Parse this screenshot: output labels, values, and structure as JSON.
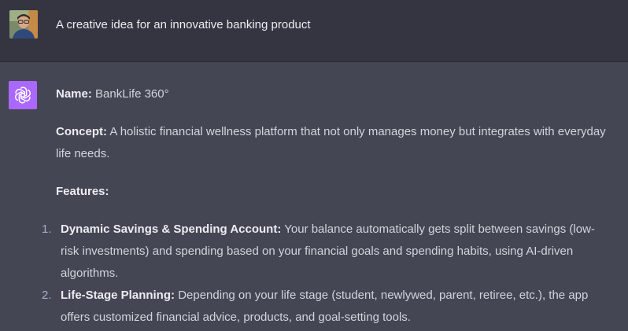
{
  "conversation": {
    "user_message": "A creative idea for an innovative banking product",
    "assistant": {
      "name_label": "Name:",
      "name_value": "BankLife 360°",
      "concept_label": "Concept:",
      "concept_value": "A holistic financial wellness platform that not only manages money but integrates with everyday life needs.",
      "features_label": "Features:",
      "features": [
        {
          "number": "1.",
          "title": "Dynamic Savings & Spending Account:",
          "text": "Your balance automatically gets split between savings (low-risk investments) and spending based on your financial goals and spending habits, using AI-driven algorithms."
        },
        {
          "number": "2.",
          "title": "Life-Stage Planning:",
          "text": "Depending on your life stage (student, newlywed, parent, retiree, etc.), the app offers customized financial advice, products, and goal-setting tools."
        }
      ]
    }
  },
  "colors": {
    "user_bg": "#343541",
    "assistant_bg": "#444654",
    "bot_icon_bg": "#ab68ff",
    "text": "#d1d5db",
    "bold_text": "#ececf1"
  },
  "icons": {
    "user_avatar": "user-avatar-photo",
    "assistant_avatar": "openai-logo-icon"
  }
}
